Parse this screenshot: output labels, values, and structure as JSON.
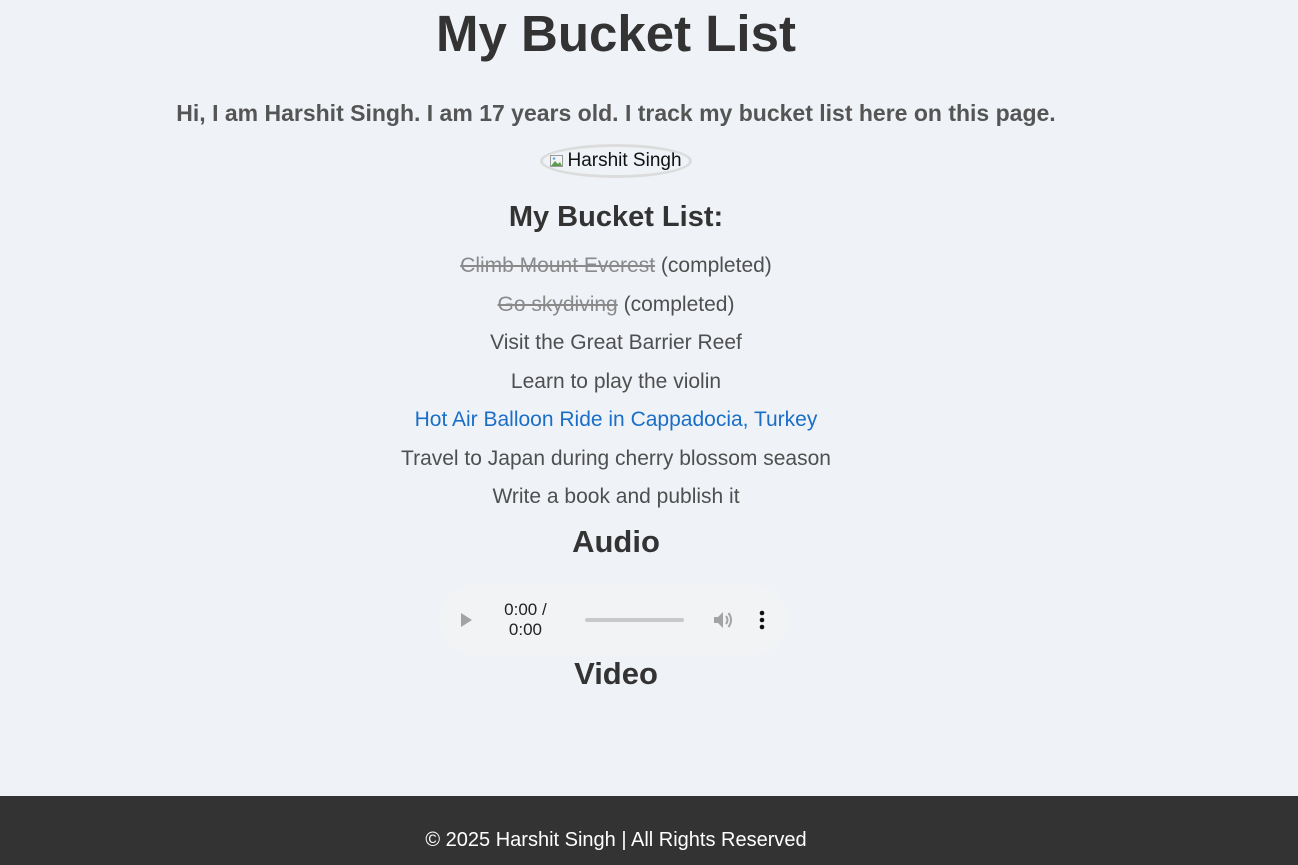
{
  "header": {
    "title": "My Bucket List",
    "intro": "Hi, I am Harshit Singh. I am 17 years old. I track my bucket list here on this page."
  },
  "profile": {
    "image_alt": "Harshit Singh"
  },
  "bucket_list": {
    "heading": "My Bucket List:",
    "completed_suffix": "(completed)",
    "items": [
      {
        "text": "Climb Mount Everest",
        "completed": true
      },
      {
        "text": "Go skydiving",
        "completed": true
      },
      {
        "text": "Visit the Great Barrier Reef",
        "completed": false
      },
      {
        "text": "Learn to play the violin",
        "completed": false
      },
      {
        "text": "Hot Air Balloon Ride in Cappadocia, Turkey",
        "completed": false,
        "link": true
      },
      {
        "text": "Travel to Japan during cherry blossom season",
        "completed": false
      },
      {
        "text": "Write a book and publish it",
        "completed": false
      }
    ]
  },
  "audio": {
    "heading": "Audio",
    "time_display": "0:00 / 0:00",
    "progress": 0
  },
  "video": {
    "heading": "Video"
  },
  "footer": {
    "text": "© 2025 Harshit Singh | All Rights Reserved"
  },
  "colors": {
    "background": "#eff3f8",
    "footer_bg": "#333333",
    "link": "#1a6ec6"
  }
}
